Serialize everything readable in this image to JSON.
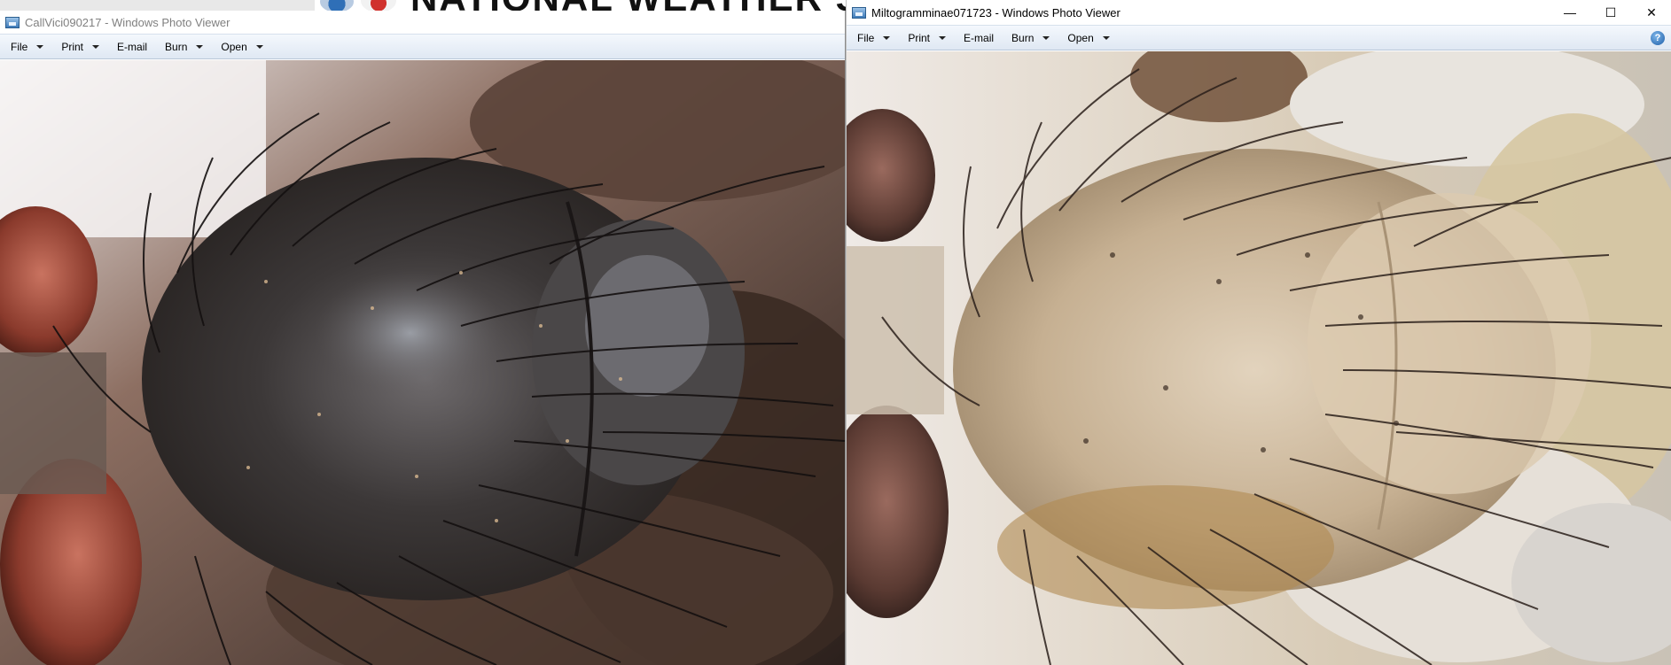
{
  "background_app": {
    "title": "NATIONAL WEATHER SERVIC"
  },
  "left_window": {
    "title": "CallVici090217 - Windows Photo Viewer",
    "menu": [
      {
        "label": "File",
        "has_dropdown": true
      },
      {
        "label": "Print",
        "has_dropdown": true
      },
      {
        "label": "E-mail",
        "has_dropdown": false
      },
      {
        "label": "Burn",
        "has_dropdown": true
      },
      {
        "label": "Open",
        "has_dropdown": true
      }
    ],
    "caption_buttons": {
      "minimize": "—"
    }
  },
  "right_window": {
    "title": "Miltogramminae071723 - Windows Photo Viewer",
    "menu": [
      {
        "label": "File",
        "has_dropdown": true
      },
      {
        "label": "Print",
        "has_dropdown": true
      },
      {
        "label": "E-mail",
        "has_dropdown": false
      },
      {
        "label": "Burn",
        "has_dropdown": true
      },
      {
        "label": "Open",
        "has_dropdown": true
      }
    ],
    "caption_buttons": {
      "minimize": "—",
      "maximize": "☐",
      "close": "✕"
    },
    "help_label": "?"
  },
  "icons": {
    "app": "photo-viewer-icon",
    "help": "help-icon",
    "dropdown": "caret-down-icon"
  },
  "colors": {
    "menubar_top": "#f4f8fd",
    "menubar_bottom": "#dfe8f3",
    "left_photo_base": "#4a4746",
    "right_photo_base": "#c9b89d"
  }
}
